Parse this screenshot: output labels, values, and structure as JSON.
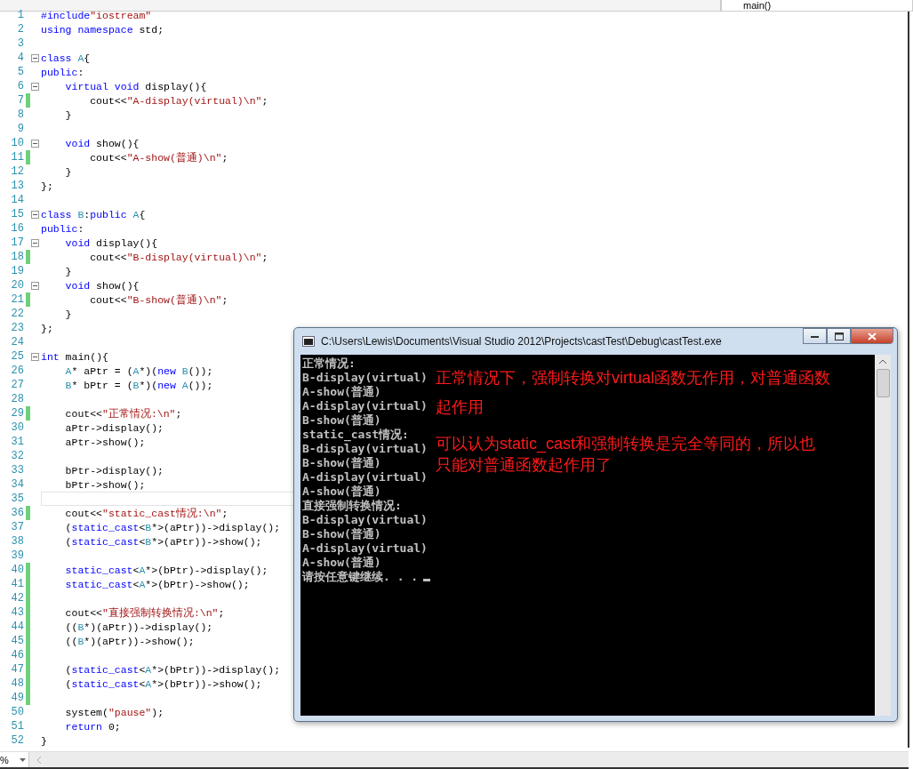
{
  "navigation_bar": {
    "member_dropdown": "main()"
  },
  "editor": {
    "lines": [
      {
        "number": "1",
        "changed": false,
        "fold": false,
        "current": false,
        "tokens": [
          {
            "kind": "keyword",
            "text": "#include"
          },
          {
            "kind": "string",
            "text": "\"iostream\""
          }
        ]
      },
      {
        "number": "2",
        "changed": false,
        "fold": false,
        "current": false,
        "tokens": [
          {
            "kind": "keyword",
            "text": "using"
          },
          {
            "kind": "keyword",
            "text": " namespace"
          },
          {
            "kind": "plain",
            "text": " std;"
          }
        ]
      },
      {
        "number": "3",
        "changed": false,
        "fold": false,
        "current": false
      },
      {
        "number": "4",
        "changed": false,
        "fold": true,
        "current": false,
        "tokens": [
          {
            "kind": "keyword",
            "text": "class"
          },
          {
            "kind": "type",
            "text": " A"
          },
          {
            "kind": "plain",
            "text": "{"
          }
        ]
      },
      {
        "number": "5",
        "changed": false,
        "fold": false,
        "current": false,
        "tokens": [
          {
            "kind": "keyword",
            "text": "public"
          },
          {
            "kind": "plain",
            "text": ":"
          }
        ]
      },
      {
        "number": "6",
        "changed": false,
        "fold": true,
        "current": false,
        "tokens": [
          {
            "kind": "keyword",
            "text": "    virtual void"
          },
          {
            "kind": "plain",
            "text": " display(){"
          }
        ]
      },
      {
        "number": "7",
        "changed": true,
        "fold": false,
        "current": false,
        "tokens": [
          {
            "kind": "plain",
            "text": "        cout<<"
          },
          {
            "kind": "string",
            "text": "\"A-display(virtual)\\n\""
          },
          {
            "kind": "plain",
            "text": ";"
          }
        ]
      },
      {
        "number": "8",
        "changed": false,
        "fold": false,
        "current": false,
        "tokens": [
          {
            "kind": "plain",
            "text": "    }"
          }
        ]
      },
      {
        "number": "9",
        "changed": false,
        "fold": false,
        "current": false
      },
      {
        "number": "10",
        "changed": false,
        "fold": true,
        "current": false,
        "tokens": [
          {
            "kind": "keyword",
            "text": "    void"
          },
          {
            "kind": "plain",
            "text": " show(){"
          }
        ]
      },
      {
        "number": "11",
        "changed": true,
        "fold": false,
        "current": false,
        "tokens": [
          {
            "kind": "plain",
            "text": "        cout<<"
          },
          {
            "kind": "string",
            "text": "\"A-show(普通)\\n\""
          },
          {
            "kind": "plain",
            "text": ";"
          }
        ]
      },
      {
        "number": "12",
        "changed": false,
        "fold": false,
        "current": false,
        "tokens": [
          {
            "kind": "plain",
            "text": "    }"
          }
        ]
      },
      {
        "number": "13",
        "changed": false,
        "fold": false,
        "current": false,
        "tokens": [
          {
            "kind": "plain",
            "text": "};"
          }
        ]
      },
      {
        "number": "14",
        "changed": false,
        "fold": false,
        "current": false
      },
      {
        "number": "15",
        "changed": false,
        "fold": true,
        "current": false,
        "tokens": [
          {
            "kind": "keyword",
            "text": "class"
          },
          {
            "kind": "type",
            "text": " B"
          },
          {
            "kind": "plain",
            "text": ":"
          },
          {
            "kind": "keyword",
            "text": "public"
          },
          {
            "kind": "type",
            "text": " A"
          },
          {
            "kind": "plain",
            "text": "{"
          }
        ]
      },
      {
        "number": "16",
        "changed": false,
        "fold": false,
        "current": false,
        "tokens": [
          {
            "kind": "keyword",
            "text": "public"
          },
          {
            "kind": "plain",
            "text": ":"
          }
        ]
      },
      {
        "number": "17",
        "changed": false,
        "fold": true,
        "current": false,
        "tokens": [
          {
            "kind": "keyword",
            "text": "    void"
          },
          {
            "kind": "plain",
            "text": " display(){"
          }
        ]
      },
      {
        "number": "18",
        "changed": true,
        "fold": false,
        "current": false,
        "tokens": [
          {
            "kind": "plain",
            "text": "        cout<<"
          },
          {
            "kind": "string",
            "text": "\"B-display(virtual)\\n\""
          },
          {
            "kind": "plain",
            "text": ";"
          }
        ]
      },
      {
        "number": "19",
        "changed": false,
        "fold": false,
        "current": false,
        "tokens": [
          {
            "kind": "plain",
            "text": "    }"
          }
        ]
      },
      {
        "number": "20",
        "changed": false,
        "fold": true,
        "current": false,
        "tokens": [
          {
            "kind": "keyword",
            "text": "    void"
          },
          {
            "kind": "plain",
            "text": " show(){"
          }
        ]
      },
      {
        "number": "21",
        "changed": true,
        "fold": false,
        "current": false,
        "tokens": [
          {
            "kind": "plain",
            "text": "        cout<<"
          },
          {
            "kind": "string",
            "text": "\"B-show(普通)\\n\""
          },
          {
            "kind": "plain",
            "text": ";"
          }
        ]
      },
      {
        "number": "22",
        "changed": false,
        "fold": false,
        "current": false,
        "tokens": [
          {
            "kind": "plain",
            "text": "    }"
          }
        ]
      },
      {
        "number": "23",
        "changed": false,
        "fold": false,
        "current": false,
        "tokens": [
          {
            "kind": "plain",
            "text": "};"
          }
        ]
      },
      {
        "number": "24",
        "changed": false,
        "fold": false,
        "current": false
      },
      {
        "number": "25",
        "changed": false,
        "fold": true,
        "current": false,
        "tokens": [
          {
            "kind": "keyword",
            "text": "int"
          },
          {
            "kind": "plain",
            "text": " main(){"
          }
        ]
      },
      {
        "number": "26",
        "changed": false,
        "fold": false,
        "current": false,
        "tokens": [
          {
            "kind": "type",
            "text": "    A"
          },
          {
            "kind": "plain",
            "text": "* aPtr = ("
          },
          {
            "kind": "type",
            "text": "A"
          },
          {
            "kind": "plain",
            "text": "*)("
          },
          {
            "kind": "keyword",
            "text": "new"
          },
          {
            "kind": "type",
            "text": " B"
          },
          {
            "kind": "plain",
            "text": "());"
          }
        ]
      },
      {
        "number": "27",
        "changed": false,
        "fold": false,
        "current": false,
        "tokens": [
          {
            "kind": "type",
            "text": "    B"
          },
          {
            "kind": "plain",
            "text": "* bPtr = ("
          },
          {
            "kind": "type",
            "text": "B"
          },
          {
            "kind": "plain",
            "text": "*)("
          },
          {
            "kind": "keyword",
            "text": "new"
          },
          {
            "kind": "type",
            "text": " A"
          },
          {
            "kind": "plain",
            "text": "());"
          }
        ]
      },
      {
        "number": "28",
        "changed": false,
        "fold": false,
        "current": false
      },
      {
        "number": "29",
        "changed": true,
        "fold": false,
        "current": false,
        "tokens": [
          {
            "kind": "plain",
            "text": "    cout<<"
          },
          {
            "kind": "string",
            "text": "\"正常情况:\\n\""
          },
          {
            "kind": "plain",
            "text": ";"
          }
        ]
      },
      {
        "number": "30",
        "changed": false,
        "fold": false,
        "current": false,
        "tokens": [
          {
            "kind": "plain",
            "text": "    aPtr->display();"
          }
        ]
      },
      {
        "number": "31",
        "changed": false,
        "fold": false,
        "current": false,
        "tokens": [
          {
            "kind": "plain",
            "text": "    aPtr->show();"
          }
        ]
      },
      {
        "number": "32",
        "changed": false,
        "fold": false,
        "current": false
      },
      {
        "number": "33",
        "changed": false,
        "fold": false,
        "current": false,
        "tokens": [
          {
            "kind": "plain",
            "text": "    bPtr->display();"
          }
        ]
      },
      {
        "number": "34",
        "changed": false,
        "fold": false,
        "current": false,
        "tokens": [
          {
            "kind": "plain",
            "text": "    bPtr->show();"
          }
        ]
      },
      {
        "number": "35",
        "changed": false,
        "fold": false,
        "current": true
      },
      {
        "number": "36",
        "changed": true,
        "fold": false,
        "current": false,
        "tokens": [
          {
            "kind": "plain",
            "text": "    cout<<"
          },
          {
            "kind": "string",
            "text": "\"static_cast情况:\\n\""
          },
          {
            "kind": "plain",
            "text": ";"
          }
        ]
      },
      {
        "number": "37",
        "changed": false,
        "fold": false,
        "current": false,
        "tokens": [
          {
            "kind": "plain",
            "text": "    ("
          },
          {
            "kind": "keyword",
            "text": "static_cast"
          },
          {
            "kind": "plain",
            "text": "<"
          },
          {
            "kind": "type",
            "text": "B"
          },
          {
            "kind": "plain",
            "text": "*>(aPtr))->display();"
          }
        ]
      },
      {
        "number": "38",
        "changed": false,
        "fold": false,
        "current": false,
        "tokens": [
          {
            "kind": "plain",
            "text": "    ("
          },
          {
            "kind": "keyword",
            "text": "static_cast"
          },
          {
            "kind": "plain",
            "text": "<"
          },
          {
            "kind": "type",
            "text": "B"
          },
          {
            "kind": "plain",
            "text": "*>(aPtr))->show();"
          }
        ]
      },
      {
        "number": "39",
        "changed": false,
        "fold": false,
        "current": false
      },
      {
        "number": "40",
        "changed": true,
        "fold": false,
        "current": false,
        "tokens": [
          {
            "kind": "keyword",
            "text": "    static_cast"
          },
          {
            "kind": "plain",
            "text": "<"
          },
          {
            "kind": "type",
            "text": "A"
          },
          {
            "kind": "plain",
            "text": "*>(bPtr)->display();"
          }
        ]
      },
      {
        "number": "41",
        "changed": true,
        "fold": false,
        "current": false,
        "tokens": [
          {
            "kind": "keyword",
            "text": "    static_cast"
          },
          {
            "kind": "plain",
            "text": "<"
          },
          {
            "kind": "type",
            "text": "A"
          },
          {
            "kind": "plain",
            "text": "*>(bPtr)->show();"
          }
        ]
      },
      {
        "number": "42",
        "changed": true,
        "fold": false,
        "current": false
      },
      {
        "number": "43",
        "changed": true,
        "fold": false,
        "current": false,
        "tokens": [
          {
            "kind": "plain",
            "text": "    cout<<"
          },
          {
            "kind": "string",
            "text": "\"直接强制转换情况:\\n\""
          },
          {
            "kind": "plain",
            "text": ";"
          }
        ]
      },
      {
        "number": "44",
        "changed": true,
        "fold": false,
        "current": false,
        "tokens": [
          {
            "kind": "plain",
            "text": "    (("
          },
          {
            "kind": "type",
            "text": "B"
          },
          {
            "kind": "plain",
            "text": "*)(aPtr))->display();"
          }
        ]
      },
      {
        "number": "45",
        "changed": true,
        "fold": false,
        "current": false,
        "tokens": [
          {
            "kind": "plain",
            "text": "    (("
          },
          {
            "kind": "type",
            "text": "B"
          },
          {
            "kind": "plain",
            "text": "*)(aPtr))->show();"
          }
        ]
      },
      {
        "number": "46",
        "changed": true,
        "fold": false,
        "current": false
      },
      {
        "number": "47",
        "changed": true,
        "fold": false,
        "current": false,
        "tokens": [
          {
            "kind": "plain",
            "text": "    ("
          },
          {
            "kind": "keyword",
            "text": "static_cast"
          },
          {
            "kind": "plain",
            "text": "<"
          },
          {
            "kind": "type",
            "text": "A"
          },
          {
            "kind": "plain",
            "text": "*>(bPtr))->display();"
          }
        ]
      },
      {
        "number": "48",
        "changed": true,
        "fold": false,
        "current": false,
        "tokens": [
          {
            "kind": "plain",
            "text": "    ("
          },
          {
            "kind": "keyword",
            "text": "static_cast"
          },
          {
            "kind": "plain",
            "text": "<"
          },
          {
            "kind": "type",
            "text": "A"
          },
          {
            "kind": "plain",
            "text": "*>(bPtr))->show();"
          }
        ]
      },
      {
        "number": "49",
        "changed": true,
        "fold": false,
        "current": false
      },
      {
        "number": "50",
        "changed": false,
        "fold": false,
        "current": false,
        "tokens": [
          {
            "kind": "plain",
            "text": "    system("
          },
          {
            "kind": "string",
            "text": "\"pause\""
          },
          {
            "kind": "plain",
            "text": ");"
          }
        ]
      },
      {
        "number": "51",
        "changed": false,
        "fold": false,
        "current": false,
        "tokens": [
          {
            "kind": "keyword",
            "text": "    return"
          },
          {
            "kind": "plain",
            "text": " 0;"
          }
        ]
      },
      {
        "number": "52",
        "changed": false,
        "fold": false,
        "current": false,
        "tokens": [
          {
            "kind": "plain",
            "text": "}"
          }
        ]
      }
    ]
  },
  "console": {
    "title": "C:\\Users\\Lewis\\Documents\\Visual Studio 2012\\Projects\\castTest\\Debug\\castTest.exe",
    "output": [
      "正常情况:",
      "B-display(virtual)",
      "A-show(普通)",
      "A-display(virtual)",
      "B-show(普通)",
      "static_cast情况:",
      "B-display(virtual)",
      "B-show(普通)",
      "A-display(virtual)",
      "A-show(普通)",
      "直接强制转换情况:",
      "B-display(virtual)",
      "B-show(普通)",
      "A-display(virtual)",
      "A-show(普通)",
      "请按任意键继续. . ."
    ],
    "annotations": [
      "正常情况下，强制转换对virtual函数无作用，对普通函数起作用",
      "可以认为static_cast和强制转换是完全等同的，所以也只能对普通函数起作用了"
    ]
  },
  "status_bar": {
    "zoom": "%"
  }
}
